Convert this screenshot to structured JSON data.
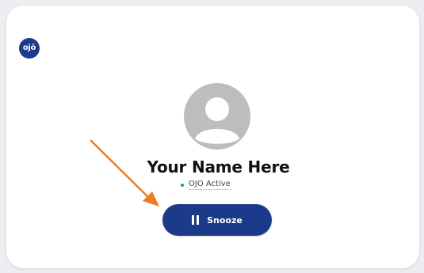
{
  "logo": {
    "text": "ojō",
    "color": "#1c3a8a"
  },
  "profile": {
    "avatar_icon": "user-avatar-placeholder-icon",
    "name": "Your Name Here",
    "status_text": "OJO Active",
    "status_color": "#1ea15a"
  },
  "snooze_button": {
    "label": "Snooze",
    "icon": "pause-icon",
    "color": "#1c3a8a"
  },
  "annotation": {
    "arrow_color": "#f07a22"
  }
}
